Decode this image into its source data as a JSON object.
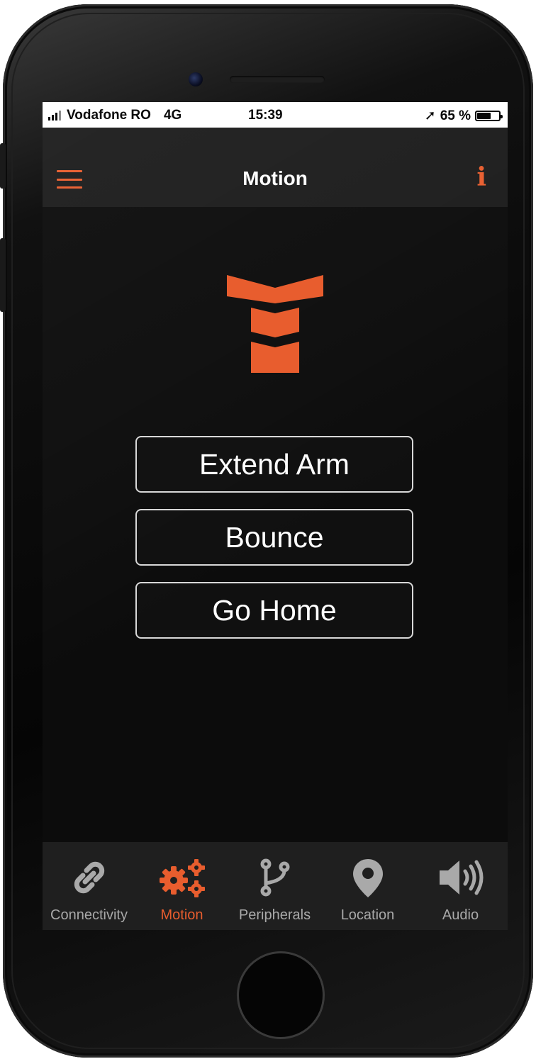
{
  "status_bar": {
    "carrier": "Vodafone RO",
    "network": "4G",
    "time": "15:39",
    "location_glyph": "➚",
    "battery": "65 %",
    "battery_level": 0.65
  },
  "nav": {
    "title": "Motion",
    "menu_icon": "hamburger-icon",
    "info_icon": "info-icon",
    "info_glyph": "i"
  },
  "actions": {
    "extend_arm": "Extend Arm",
    "bounce": "Bounce",
    "go_home": "Go Home"
  },
  "tabs": [
    {
      "label": "Connectivity",
      "icon": "link-icon",
      "active": false
    },
    {
      "label": "Motion",
      "icon": "gears-icon",
      "active": true
    },
    {
      "label": "Peripherals",
      "icon": "branch-icon",
      "active": false
    },
    {
      "label": "Location",
      "icon": "map-pin-icon",
      "active": false
    },
    {
      "label": "Audio",
      "icon": "speaker-icon",
      "active": false
    }
  ],
  "colors": {
    "accent": "#e85d2e",
    "background": "#0c0c0c",
    "nav_bg": "#1c1c1c",
    "tab_bg": "#1f1f1f",
    "inactive": "#a9a9a9"
  }
}
